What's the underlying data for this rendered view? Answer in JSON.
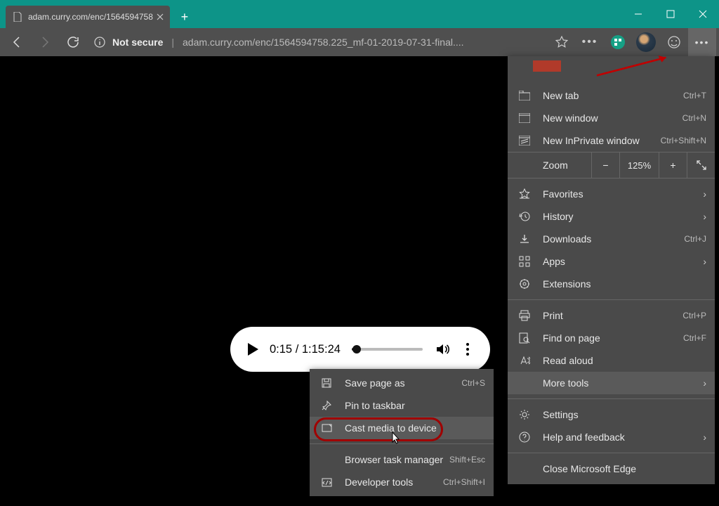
{
  "tab": {
    "title": "adam.curry.com/enc/1564594758"
  },
  "addressbar": {
    "not_secure": "Not secure",
    "url": "adam.curry.com/enc/1564594758.225_mf-01-2019-07-31-final...."
  },
  "player": {
    "time": "0:15 / 1:15:24"
  },
  "mainmenu": {
    "items": [
      {
        "label": "New tab",
        "shortcut": "Ctrl+T",
        "icon": "new-tab"
      },
      {
        "label": "New window",
        "shortcut": "Ctrl+N",
        "icon": "new-window"
      },
      {
        "label": "New InPrivate window",
        "shortcut": "Ctrl+Shift+N",
        "icon": "inprivate"
      }
    ],
    "zoom": {
      "label": "Zoom",
      "value": "125%"
    },
    "items2": [
      {
        "label": "Favorites",
        "arrow": true,
        "icon": "star"
      },
      {
        "label": "History",
        "arrow": true,
        "icon": "history"
      },
      {
        "label": "Downloads",
        "shortcut": "Ctrl+J",
        "icon": "download"
      },
      {
        "label": "Apps",
        "arrow": true,
        "icon": "apps"
      },
      {
        "label": "Extensions",
        "icon": "extensions"
      }
    ],
    "items3": [
      {
        "label": "Print",
        "shortcut": "Ctrl+P",
        "icon": "print"
      },
      {
        "label": "Find on page",
        "shortcut": "Ctrl+F",
        "icon": "find"
      },
      {
        "label": "Read aloud",
        "icon": "read-aloud"
      },
      {
        "label": "More tools",
        "arrow": true,
        "hovered": true
      }
    ],
    "items4": [
      {
        "label": "Settings",
        "icon": "settings"
      },
      {
        "label": "Help and feedback",
        "arrow": true,
        "icon": "help"
      }
    ],
    "items5": [
      {
        "label": "Close Microsoft Edge"
      }
    ]
  },
  "submenu": {
    "items": [
      {
        "label": "Save page as",
        "shortcut": "Ctrl+S",
        "icon": "save"
      },
      {
        "label": "Pin to taskbar",
        "icon": "pin"
      },
      {
        "label": "Cast media to device",
        "icon": "cast",
        "hovered": true
      },
      {
        "label": "Browser task manager",
        "shortcut": "Shift+Esc"
      },
      {
        "label": "Developer tools",
        "shortcut": "Ctrl+Shift+I",
        "icon": "devtools"
      }
    ]
  }
}
